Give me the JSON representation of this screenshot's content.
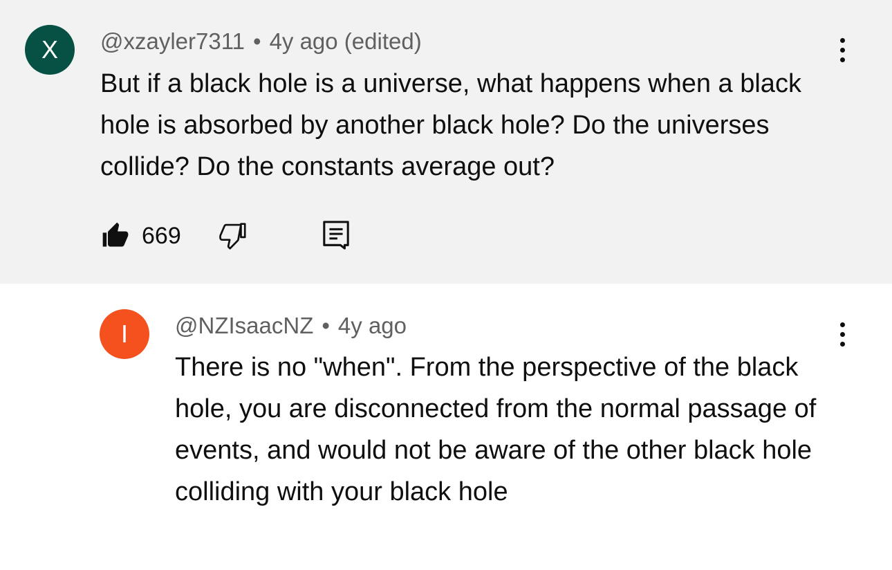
{
  "comment": {
    "avatar_letter": "X",
    "avatar_color": "#065143",
    "handle": "@xzayler7311",
    "separator": "•",
    "time": "4y ago (edited)",
    "text": "But if a black hole is a universe, what happens when a black hole is absorbed by another black hole? Do the universes collide? Do the constants average out?",
    "like_count": "669",
    "like_icon": "thumbs-up-filled-icon",
    "dislike_icon": "thumbs-down-outline-icon",
    "reply_icon": "comment-reply-icon",
    "menu_icon": "more-vert-icon"
  },
  "reply": {
    "avatar_letter": "I",
    "avatar_color": "#f4511e",
    "handle": "@NZIsaacNZ",
    "separator": "•",
    "time": "4y ago",
    "text": "There is no \"when\". From the perspective of the black hole, you are disconnected from the normal passage of events, and would not be aware of the other black hole colliding with your black hole",
    "menu_icon": "more-vert-icon"
  },
  "colors": {
    "highlight_bg": "#f2f2f2",
    "text_primary": "#0f0f0f",
    "text_secondary": "#606060"
  }
}
